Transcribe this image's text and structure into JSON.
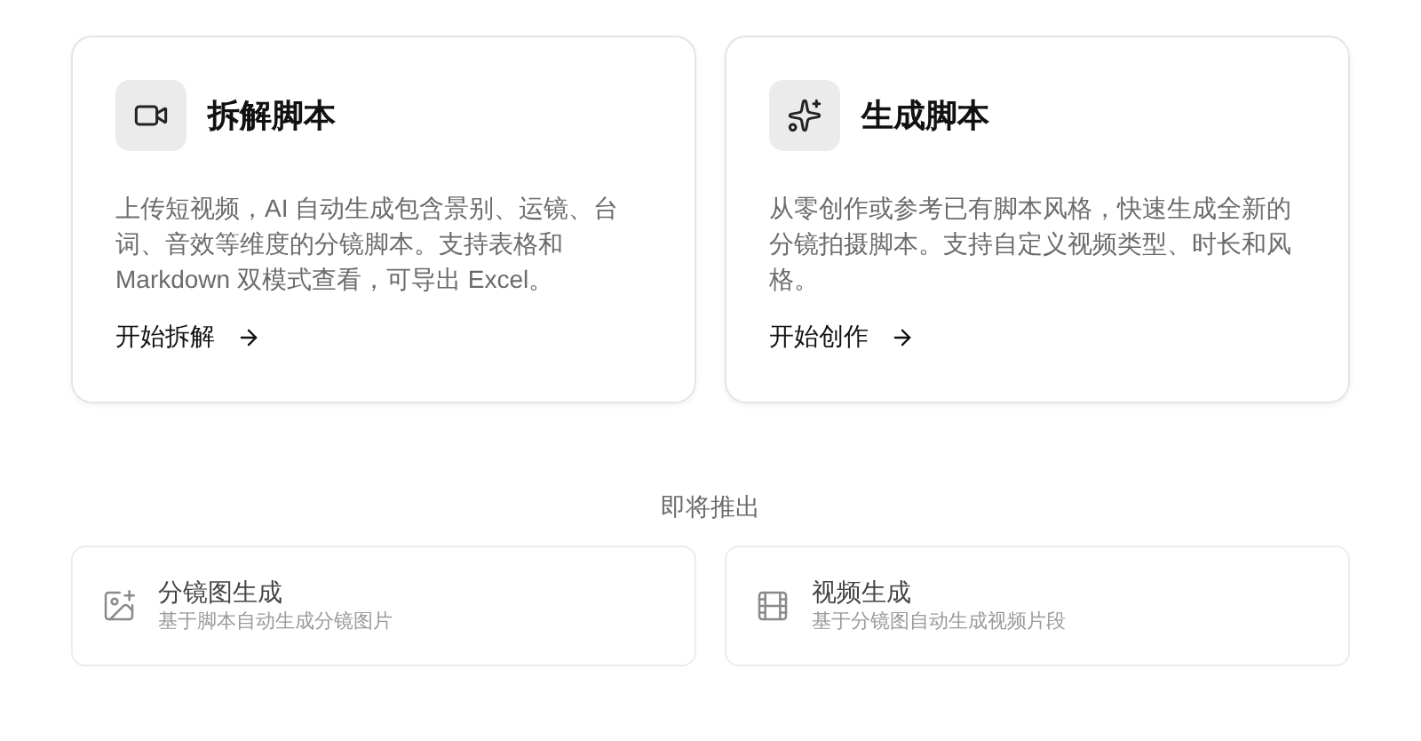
{
  "feature_cards": [
    {
      "title": "拆解脚本",
      "description": "上传短视频，AI 自动生成包含景别、运镜、台词、音效等维度的分镜脚本。支持表格和 Markdown 双模式查看，可导出 Excel。",
      "link": "开始拆解"
    },
    {
      "title": "生成脚本",
      "description": "从零创作或参考已有脚本风格，快速生成全新的分镜拍摄脚本。支持自定义视频类型、时长和风格。",
      "link": "开始创作"
    }
  ],
  "coming_soon": {
    "heading": "即将推出",
    "items": [
      {
        "title": "分镜图生成",
        "subtitle": "基于脚本自动生成分镜图片"
      },
      {
        "title": "视频生成",
        "subtitle": "基于分镜图自动生成视频片段"
      }
    ]
  }
}
